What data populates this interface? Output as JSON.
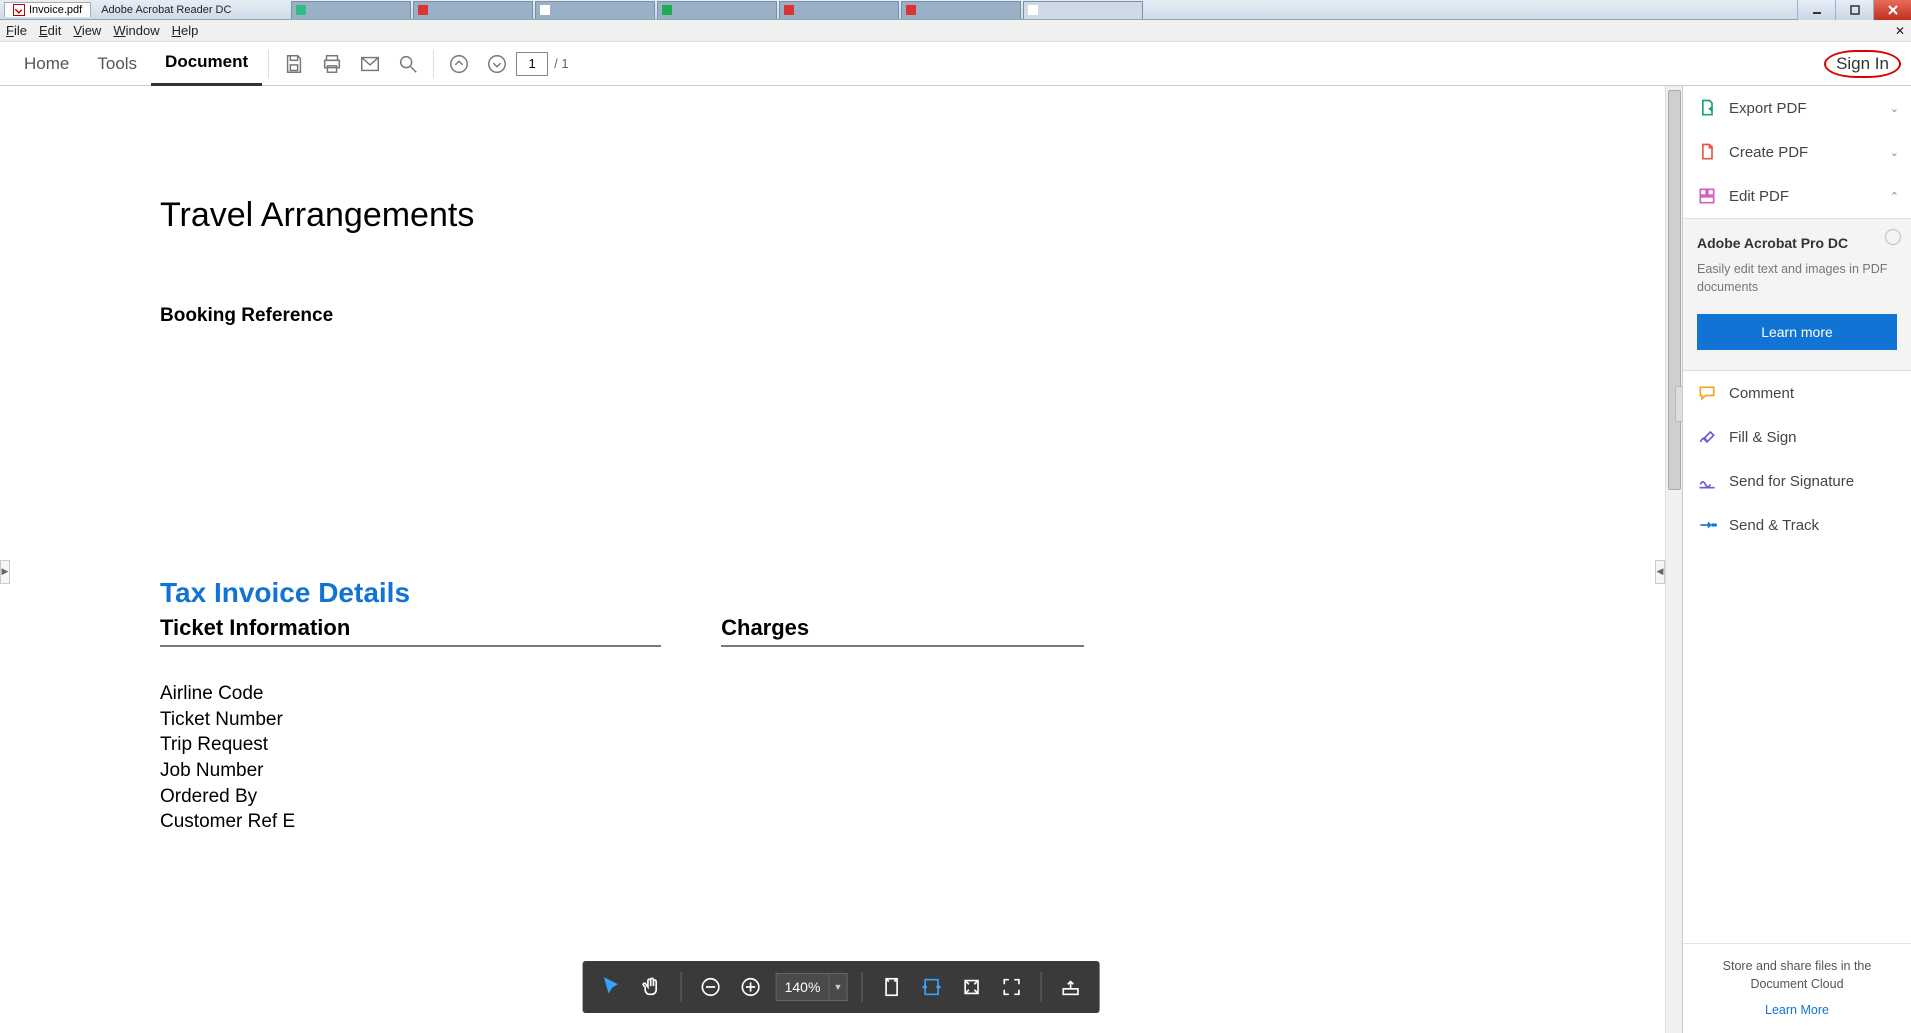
{
  "titlebar": {
    "doc_name": "Invoice.pdf",
    "app_name": "Adobe Acrobat Reader DC",
    "browser_tabs": [
      "",
      "",
      "",
      "",
      "",
      "",
      ""
    ]
  },
  "menubar": {
    "file": "File",
    "edit": "Edit",
    "view": "View",
    "window": "Window",
    "help": "Help"
  },
  "toolbar": {
    "home": "Home",
    "tools": "Tools",
    "document": "Document",
    "page_current": "1",
    "page_total": "/  1",
    "signin": "Sign In"
  },
  "document": {
    "title": "Travel Arrangements",
    "booking_ref": "Booking Reference",
    "tax_title": "Tax Invoice Details",
    "ticket_header": "Ticket Information",
    "charges_header": "Charges",
    "fields": [
      "Airline Code",
      "Ticket Number",
      "Trip Request",
      "Job Number",
      "Ordered By",
      "Customer Ref E"
    ]
  },
  "float_tb": {
    "zoom": "140%"
  },
  "rpanel": {
    "export": "Export PDF",
    "create": "Create PDF",
    "edit": "Edit PDF",
    "promo_title": "Adobe Acrobat Pro DC",
    "promo_text": "Easily edit text and images in PDF documents",
    "learn_more": "Learn more",
    "comment": "Comment",
    "fillsign": "Fill & Sign",
    "sendsig": "Send for Signature",
    "sendtrack": "Send & Track",
    "store_text": "Store and share files in the Document Cloud",
    "store_link": "Learn More"
  }
}
